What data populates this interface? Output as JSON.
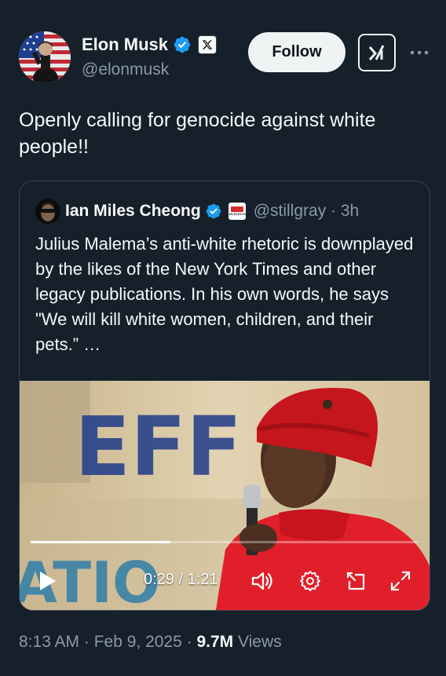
{
  "author": {
    "name": "Elon Musk",
    "handle": "@elonmusk",
    "affiliation_badge": "X"
  },
  "actions": {
    "follow_label": "Follow",
    "grok_icon": "grok-icon",
    "more_icon": "more-icon"
  },
  "tweet": {
    "text": "Openly calling for genocide against white people!!"
  },
  "quote": {
    "author_name": "Ian Miles Cheong",
    "affiliation_badge": "ROAD ELECTION",
    "handle_time": "@stillgray · 3h",
    "text": "Julius Malema’s anti-white rhetoric  is downplayed by the likes of the New York Times and other legacy publications. In his own words, he says \"We will kill white women, children, and their pets.” …",
    "video": {
      "backdrop_text_top": "EFF",
      "backdrop_text_bottom": "ATIO",
      "time": "0:29 / 1:21",
      "progress": 0.36
    }
  },
  "footer": {
    "time_date": "8:13 AM · Feb 9, 2025 · ",
    "views_count": "9.7M",
    "views_label": " Views"
  },
  "colors": {
    "background": "#15202b",
    "text_primary": "#f7f9f9",
    "text_secondary": "#8b98a5",
    "verified_blue": "#1d9bf0",
    "border": "#38444d"
  }
}
